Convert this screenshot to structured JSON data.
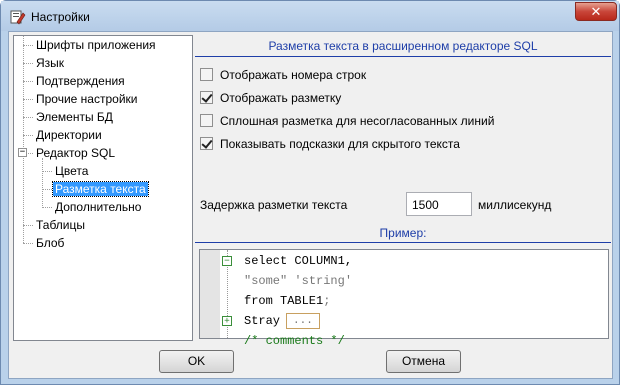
{
  "window": {
    "title": "Настройки"
  },
  "tree": {
    "items": [
      "Шрифты приложения",
      "Язык",
      "Подтверждения",
      "Прочие настройки",
      "Элементы БД",
      "Директории",
      "Редактор SQL",
      "Цвета",
      "Разметка текста",
      "Дополнительно",
      "Таблицы",
      "Блоб"
    ],
    "selected": "Разметка текста",
    "expander_symbol": "−"
  },
  "panel": {
    "title": "Разметка текста в расширенном редакторе SQL",
    "options": [
      {
        "label": "Отображать номера строк",
        "checked": false
      },
      {
        "label": "Отображать разметку",
        "checked": true
      },
      {
        "label": "Сплошная разметка для несогласованных линий",
        "checked": false
      },
      {
        "label": "Показывать подсказки для скрытого текста",
        "checked": true
      }
    ],
    "delay": {
      "label": "Задержка разметки текста",
      "value": "1500",
      "unit": "миллисекунд"
    },
    "example_title": "Пример:",
    "code": {
      "line1": "select COLUMN1,",
      "line2_a": "\"some\"",
      "line2_b": "'string'",
      "line3_a": "from TABLE1",
      "line3_b": ";",
      "line4": "Stray",
      "line4_hidden": "...",
      "line5": "/* comments */"
    }
  },
  "buttons": {
    "ok": "OK",
    "cancel": "Отмена"
  },
  "colors": {
    "accent": "#1e3ea8",
    "selection": "#3399ff",
    "comment": "#1a7a1a"
  }
}
